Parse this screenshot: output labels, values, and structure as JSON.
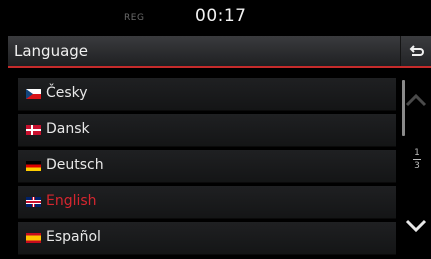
{
  "status": {
    "tag": "REG",
    "time": "00:17"
  },
  "header": {
    "title": "Language"
  },
  "languages": [
    {
      "label": "Česky",
      "flag": "cz-flag-icon",
      "selected": false
    },
    {
      "label": "Dansk",
      "flag": "dk-flag-icon",
      "selected": false
    },
    {
      "label": "Deutsch",
      "flag": "de-flag-icon",
      "selected": false
    },
    {
      "label": "English",
      "flag": "gb-flag-icon",
      "selected": true
    },
    {
      "label": "Español",
      "flag": "es-flag-icon",
      "selected": false
    }
  ],
  "pagination": {
    "current": "1",
    "total": "3"
  },
  "colors": {
    "accent": "#c52b2b",
    "selected_text": "#d6262f"
  }
}
